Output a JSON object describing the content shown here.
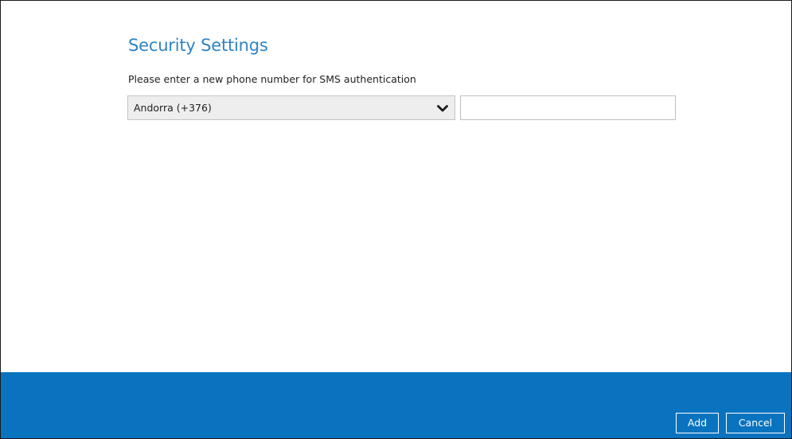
{
  "dialog": {
    "title": "Security Settings",
    "instruction": "Please enter a new phone number for SMS authentication"
  },
  "country_select": {
    "selected": "Andorra (+376)",
    "icon": "chevron-down-icon"
  },
  "phone_input": {
    "value": "",
    "placeholder": ""
  },
  "footer": {
    "add_label": "Add",
    "cancel_label": "Cancel"
  },
  "colors": {
    "title": "#2e84c5",
    "footer_bg": "#0a73bf",
    "select_bg": "#eeeeee"
  }
}
